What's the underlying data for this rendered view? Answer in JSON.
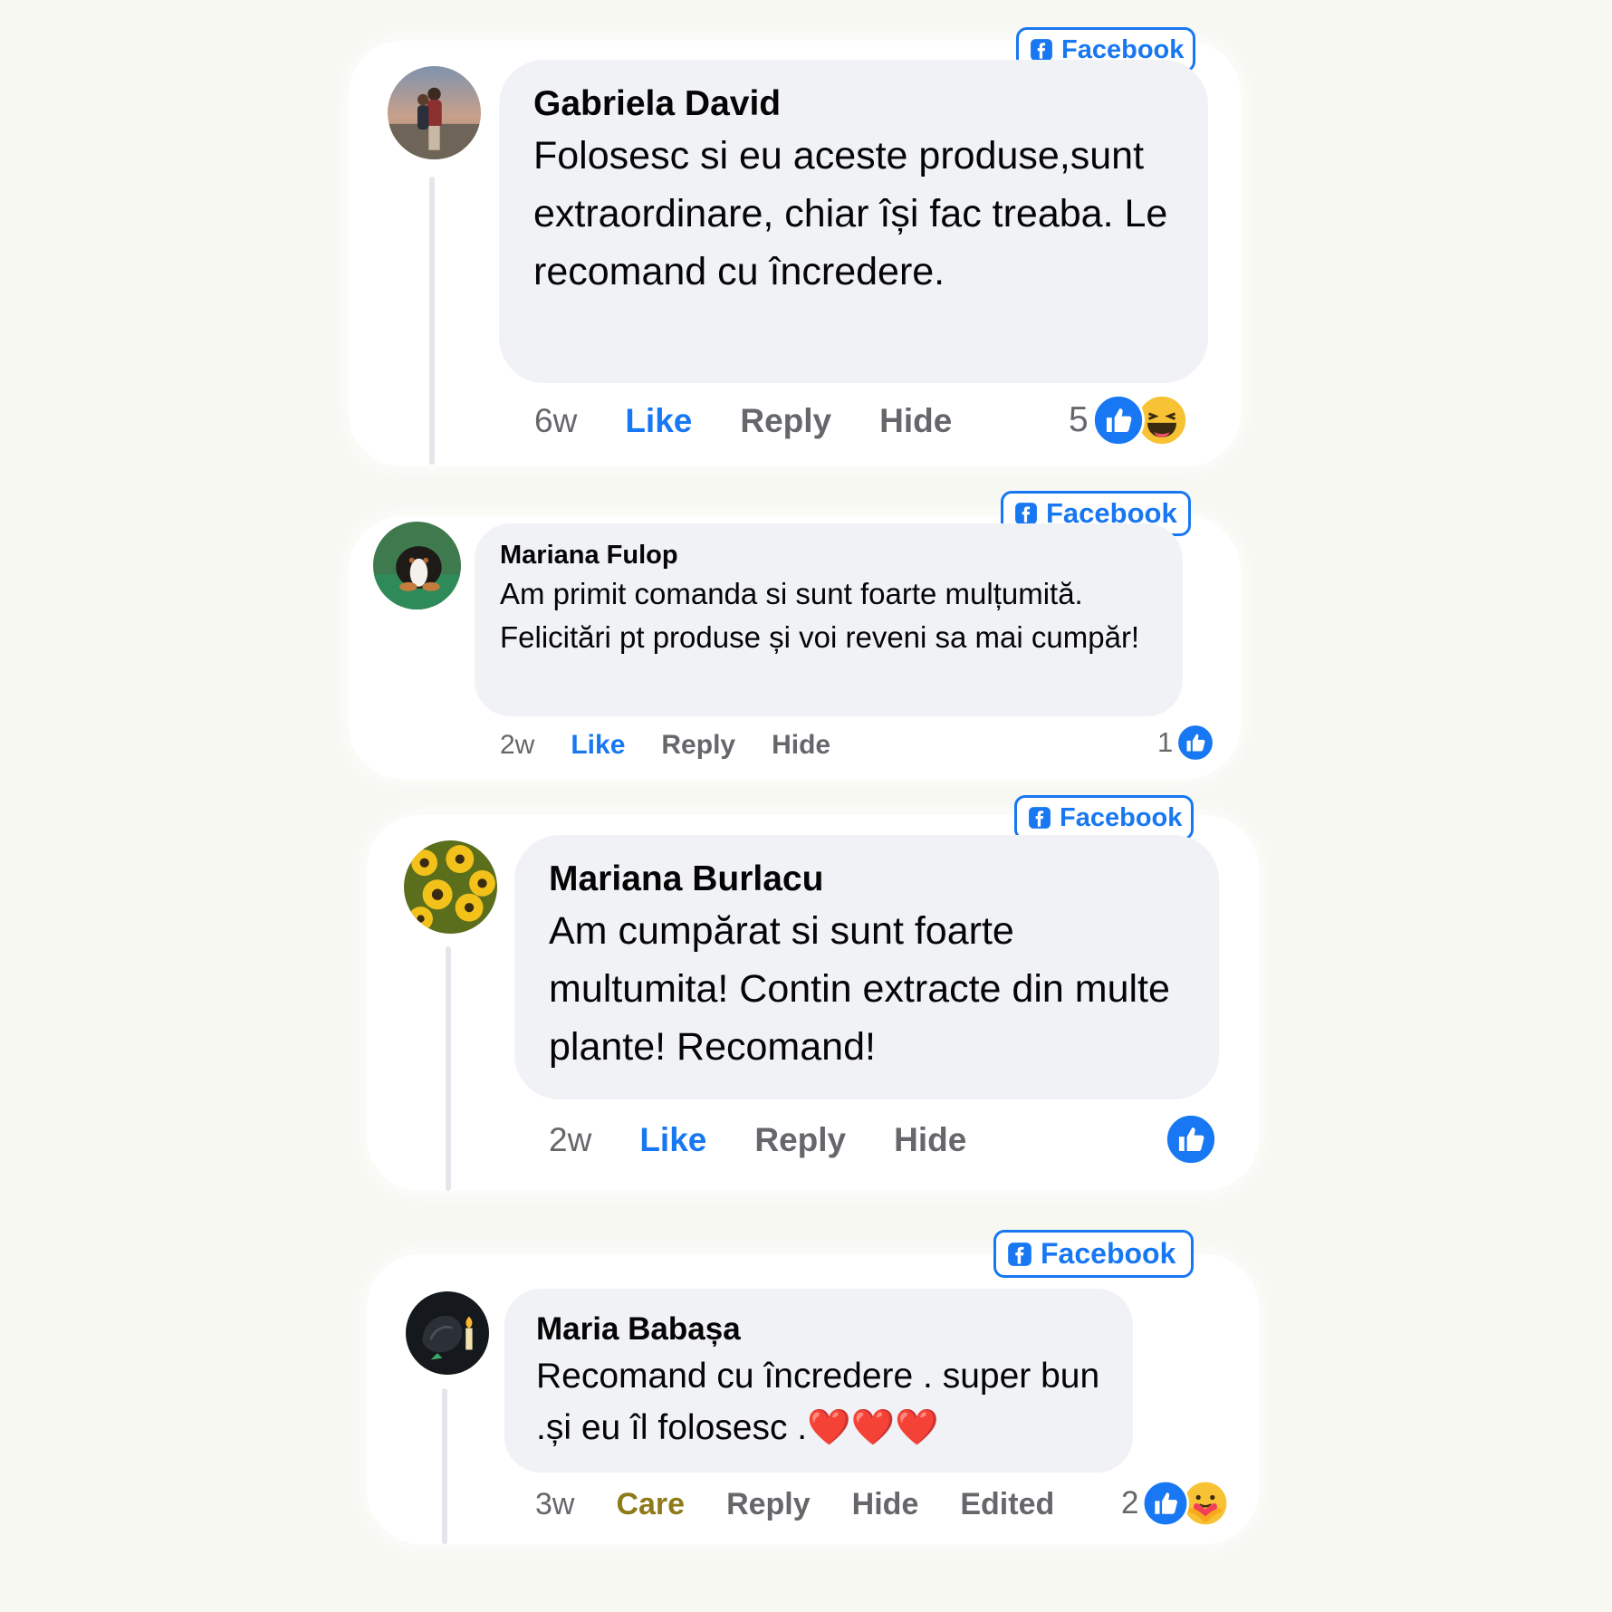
{
  "colors": {
    "page_background": "#f8f8f3",
    "card_background": "#ffffff",
    "bubble_background": "#f0f2f5",
    "facebook_blue": "#1877f2",
    "secondary_text": "#65676b",
    "care_color": "#8f7a1a",
    "heart_red": "#e0182d"
  },
  "badge_label": "Facebook",
  "comments": [
    {
      "author": "Gabriela David",
      "text": "Folosesc si eu aceste produse,sunt extraordinare, chiar își fac treaba. Le recomand cu încredere.",
      "time": "6w",
      "reaction_action": "Like",
      "reply": "Reply",
      "hide": "Hide",
      "reaction_count": "5",
      "reaction_icons": [
        "like-icon",
        "haha-icon"
      ]
    },
    {
      "author": "Mariana Fulop",
      "text": "Am primit comanda si sunt foarte mulțumită. Felicitări pt produse și voi reveni sa mai cumpăr!",
      "time": "2w",
      "reaction_action": "Like",
      "reply": "Reply",
      "hide": "Hide",
      "reaction_count": "1",
      "reaction_icons": [
        "like-icon"
      ]
    },
    {
      "author": "Mariana Burlacu",
      "text": "Am cumpărat si sunt foarte multumita! Contin extracte din multe plante! Recomand!",
      "time": "2w",
      "reaction_action": "Like",
      "reply": "Reply",
      "hide": "Hide",
      "reaction_count": "",
      "reaction_icons": [
        "like-icon"
      ]
    },
    {
      "author": "Maria Babașa",
      "text": "Recomand cu încredere . super bun .și eu îl folosesc .",
      "emoji": "❤️❤️❤️",
      "time": "3w",
      "reaction_action": "Care",
      "reply": "Reply",
      "hide": "Hide",
      "edited": "Edited",
      "reaction_count": "2",
      "reaction_icons": [
        "like-icon",
        "care-icon"
      ]
    }
  ]
}
